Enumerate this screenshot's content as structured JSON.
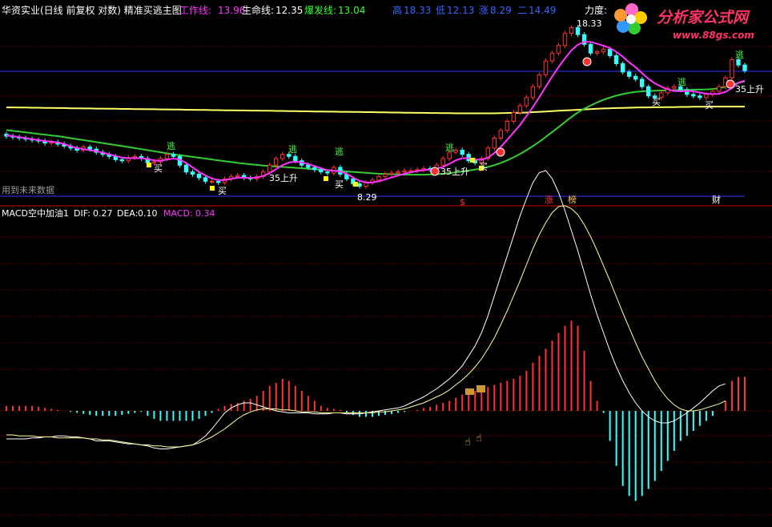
{
  "header": {
    "title": "华资实业(日线 前复权 对数) 精准买逃主图",
    "work_line": {
      "label": "工作线:",
      "value": "13.96",
      "color": "#ff33ff"
    },
    "life_line": {
      "label": "生命线:",
      "value": "12.35",
      "color": "#ffffff"
    },
    "burst_line": {
      "label": "爆发线:",
      "value": "13.04",
      "color": "#33ff33"
    },
    "ohlc": [
      {
        "label": "高",
        "value": "18.33"
      },
      {
        "label": "低",
        "value": "12.13"
      },
      {
        "label": "涨",
        "value": "8.29"
      },
      {
        "label": "二",
        "value": "14.49"
      }
    ],
    "force_label": "力度:"
  },
  "watermark": {
    "brand": "分析家公式网",
    "url": "www.88gs.com"
  },
  "future_note": "用到未来数据",
  "signals": {
    "buy": "买",
    "escape": "逃",
    "rise35": "35上升",
    "high_marker": "18.33",
    "low_marker": "8.29",
    "bottom_marks": [
      "$",
      "涨",
      "榜",
      "财"
    ]
  },
  "macd_header": {
    "name": "MACD空中加油1",
    "dif": {
      "label": "DIF:",
      "value": "0.27",
      "color": "#ffffff"
    },
    "dea": {
      "label": "DEA:",
      "value": "0.10",
      "color": "#ffffff"
    },
    "macd": {
      "label": "MACD:",
      "value": "0.34",
      "color": "#ff33ff"
    }
  },
  "colors": {
    "up": "#ff3333",
    "down": "#33ffff",
    "grid": "#8b0000",
    "ma_long": "#ffff66",
    "ma_mid": "#33cc33",
    "ma_short": "#ff33ff",
    "blue_line": "#3333ff"
  },
  "chart_data": [
    {
      "type": "candlestick",
      "title": "华资实业(日线 前复权 对数) 精准买逃主图",
      "n": 116,
      "ylim": [
        8.0,
        19.0
      ],
      "series": [
        {
          "name": "工作线",
          "value": 13.96
        },
        {
          "name": "生命线",
          "value": 12.35
        },
        {
          "name": "爆发线",
          "value": 13.04
        }
      ],
      "close": [
        10.7,
        10.65,
        10.6,
        10.55,
        10.5,
        10.45,
        10.35,
        10.4,
        10.3,
        10.2,
        10.1,
        10.0,
        10.15,
        10.05,
        9.9,
        9.8,
        9.7,
        9.55,
        9.5,
        9.65,
        9.7,
        9.6,
        9.4,
        9.45,
        9.6,
        9.8,
        9.7,
        9.3,
        9.0,
        8.9,
        8.75,
        8.6,
        8.6,
        8.55,
        8.7,
        8.8,
        8.85,
        8.75,
        8.7,
        8.8,
        9.0,
        9.3,
        9.6,
        9.8,
        9.7,
        9.5,
        9.3,
        9.2,
        9.1,
        9.0,
        8.95,
        9.2,
        8.9,
        8.7,
        8.5,
        8.4,
        8.55,
        8.65,
        8.8,
        8.9,
        8.95,
        9.0,
        9.05,
        9.05,
        9.1,
        9.15,
        9.1,
        9.3,
        9.6,
        9.9,
        10.0,
        9.8,
        9.5,
        9.4,
        9.6,
        10.1,
        10.6,
        11.0,
        11.5,
        12.0,
        12.4,
        12.9,
        13.6,
        14.4,
        15.4,
        16.0,
        16.6,
        17.6,
        18.1,
        17.5,
        16.7,
        16.0,
        16.1,
        16.3,
        15.8,
        15.2,
        14.6,
        14.3,
        14.1,
        13.6,
        13.0,
        12.9,
        13.2,
        13.5,
        13.6,
        13.4,
        13.1,
        13.0,
        12.9,
        13.1,
        13.3,
        13.6,
        14.2,
        15.5,
        15.1,
        14.7
      ],
      "ma_short": [
        10.75,
        10.7,
        10.65,
        10.6,
        10.55,
        10.5,
        10.45,
        10.42,
        10.38,
        10.3,
        10.2,
        10.1,
        10.05,
        10.0,
        9.95,
        9.88,
        9.8,
        9.72,
        9.65,
        9.62,
        9.62,
        9.62,
        9.58,
        9.52,
        9.5,
        9.55,
        9.6,
        9.55,
        9.4,
        9.2,
        9.0,
        8.85,
        8.72,
        8.65,
        8.65,
        8.7,
        8.75,
        8.75,
        8.74,
        8.76,
        8.82,
        8.95,
        9.12,
        9.3,
        9.42,
        9.46,
        9.42,
        9.35,
        9.26,
        9.16,
        9.08,
        9.05,
        9.02,
        8.92,
        8.76,
        8.62,
        8.55,
        8.55,
        8.6,
        8.68,
        8.76,
        8.84,
        8.92,
        8.98,
        9.04,
        9.08,
        9.1,
        9.14,
        9.22,
        9.36,
        9.52,
        9.62,
        9.62,
        9.56,
        9.54,
        9.64,
        9.86,
        10.16,
        10.52,
        10.9,
        11.3,
        11.8,
        12.32,
        12.92,
        13.6,
        14.28,
        14.96,
        15.6,
        16.22,
        16.66,
        16.9,
        16.9,
        16.74,
        16.58,
        16.4,
        16.1,
        15.72,
        15.3,
        14.94,
        14.52,
        14.12,
        13.82,
        13.6,
        13.42,
        13.32,
        13.3,
        13.32,
        13.3,
        13.22,
        13.14,
        13.12,
        13.14,
        13.26,
        13.5,
        13.86,
        14.0
      ],
      "ma_mid": [
        11.02,
        10.98,
        10.94,
        10.9,
        10.86,
        10.82,
        10.78,
        10.74,
        10.7,
        10.65,
        10.6,
        10.55,
        10.5,
        10.45,
        10.4,
        10.35,
        10.3,
        10.25,
        10.2,
        10.15,
        10.1,
        10.05,
        10.0,
        9.95,
        9.9,
        9.85,
        9.8,
        9.76,
        9.72,
        9.68,
        9.64,
        9.6,
        9.56,
        9.52,
        9.48,
        9.44,
        9.4,
        9.37,
        9.34,
        9.31,
        9.28,
        9.26,
        9.24,
        9.22,
        9.2,
        9.18,
        9.16,
        9.14,
        9.12,
        9.1,
        9.08,
        9.06,
        9.04,
        9.02,
        9.0,
        8.98,
        8.96,
        8.94,
        8.92,
        8.91,
        8.9,
        8.89,
        8.88,
        8.88,
        8.88,
        8.88,
        8.89,
        8.9,
        8.92,
        8.95,
        8.98,
        9.02,
        9.06,
        9.1,
        9.16,
        9.22,
        9.3,
        9.4,
        9.52,
        9.66,
        9.82,
        10.0,
        10.2,
        10.42,
        10.66,
        10.92,
        11.18,
        11.46,
        11.74,
        12.0,
        12.22,
        12.42,
        12.6,
        12.76,
        12.9,
        13.02,
        13.12,
        13.2,
        13.26,
        13.3,
        13.32,
        13.34,
        13.35,
        13.36,
        13.37,
        13.38,
        13.39,
        13.4,
        13.41,
        13.42,
        13.45,
        13.5,
        13.6,
        13.72,
        13.85,
        13.96
      ],
      "ma_long": [
        12.3,
        12.3,
        12.29,
        12.29,
        12.28,
        12.28,
        12.27,
        12.27,
        12.26,
        12.26,
        12.25,
        12.25,
        12.24,
        12.24,
        12.23,
        12.23,
        12.22,
        12.22,
        12.21,
        12.21,
        12.2,
        12.2,
        12.19,
        12.19,
        12.18,
        12.18,
        12.17,
        12.17,
        12.16,
        12.16,
        12.15,
        12.15,
        12.14,
        12.14,
        12.13,
        12.13,
        12.12,
        12.12,
        12.11,
        12.11,
        12.1,
        12.1,
        12.09,
        12.09,
        12.08,
        12.08,
        12.07,
        12.07,
        12.06,
        12.06,
        12.05,
        12.05,
        12.04,
        12.04,
        12.03,
        12.03,
        12.02,
        12.02,
        12.01,
        12.01,
        12.0,
        12.0,
        11.99,
        11.99,
        11.98,
        11.98,
        11.97,
        11.97,
        11.96,
        11.96,
        11.95,
        11.95,
        11.95,
        11.95,
        11.95,
        11.95,
        11.95,
        11.96,
        11.97,
        11.98,
        11.99,
        12.0,
        12.02,
        12.04,
        12.06,
        12.08,
        12.1,
        12.12,
        12.14,
        12.16,
        12.18,
        12.2,
        12.22,
        12.24,
        12.25,
        12.26,
        12.27,
        12.28,
        12.29,
        12.3,
        12.3,
        12.31,
        12.31,
        12.32,
        12.32,
        12.33,
        12.33,
        12.34,
        12.34,
        12.34,
        12.35,
        12.35,
        12.35,
        12.35,
        12.35,
        12.35
      ]
    },
    {
      "type": "bar",
      "title": "MACD空中加油1",
      "series": [
        {
          "name": "DIF",
          "value": 0.27
        },
        {
          "name": "DEA",
          "value": 0.1
        },
        {
          "name": "MACD",
          "value": 0.34
        }
      ],
      "hist": [
        0.05,
        0.05,
        0.05,
        0.05,
        0.05,
        0.04,
        0.03,
        0.02,
        0.01,
        0.0,
        -0.01,
        -0.02,
        -0.03,
        -0.04,
        -0.05,
        -0.05,
        -0.05,
        -0.05,
        -0.04,
        -0.03,
        -0.02,
        -0.01,
        -0.05,
        -0.08,
        -0.1,
        -0.1,
        -0.1,
        -0.1,
        -0.1,
        -0.1,
        -0.08,
        -0.05,
        -0.02,
        0.02,
        0.05,
        0.07,
        0.08,
        0.1,
        0.12,
        0.15,
        0.2,
        0.25,
        0.28,
        0.32,
        0.3,
        0.25,
        0.2,
        0.15,
        0.1,
        0.05,
        0.03,
        0.02,
        0.01,
        -0.02,
        -0.04,
        -0.06,
        -0.06,
        -0.06,
        -0.05,
        -0.04,
        -0.03,
        -0.02,
        -0.01,
        0.0,
        0.01,
        0.03,
        0.04,
        0.06,
        0.08,
        0.1,
        0.13,
        0.16,
        0.18,
        0.2,
        0.22,
        0.24,
        0.26,
        0.28,
        0.3,
        0.32,
        0.35,
        0.4,
        0.48,
        0.55,
        0.62,
        0.7,
        0.78,
        0.85,
        0.9,
        0.85,
        0.6,
        0.3,
        0.1,
        -0.02,
        -0.3,
        -0.55,
        -0.75,
        -0.85,
        -0.9,
        -0.85,
        -0.78,
        -0.7,
        -0.6,
        -0.5,
        -0.4,
        -0.3,
        -0.25,
        -0.2,
        -0.15,
        -0.1,
        -0.05,
        0.0,
        0.1,
        0.3,
        0.34,
        0.34
      ],
      "dif": [
        -0.28,
        -0.28,
        -0.28,
        -0.28,
        -0.27,
        -0.27,
        -0.26,
        -0.26,
        -0.25,
        -0.25,
        -0.26,
        -0.26,
        -0.27,
        -0.28,
        -0.3,
        -0.3,
        -0.3,
        -0.31,
        -0.32,
        -0.33,
        -0.33,
        -0.34,
        -0.35,
        -0.37,
        -0.38,
        -0.38,
        -0.37,
        -0.36,
        -0.35,
        -0.34,
        -0.3,
        -0.25,
        -0.18,
        -0.1,
        -0.02,
        0.03,
        0.06,
        0.08,
        0.08,
        0.06,
        0.04,
        0.02,
        0.0,
        -0.01,
        -0.02,
        -0.02,
        -0.02,
        -0.02,
        -0.03,
        -0.03,
        -0.03,
        -0.02,
        -0.02,
        -0.03,
        -0.03,
        -0.03,
        -0.02,
        -0.01,
        0.0,
        0.01,
        0.02,
        0.03,
        0.05,
        0.08,
        0.11,
        0.14,
        0.18,
        0.22,
        0.27,
        0.32,
        0.38,
        0.45,
        0.55,
        0.65,
        0.78,
        0.95,
        1.15,
        1.35,
        1.55,
        1.75,
        1.95,
        2.12,
        2.28,
        2.38,
        2.4,
        2.32,
        2.18,
        2.0,
        1.8,
        1.6,
        1.38,
        1.16,
        0.96,
        0.78,
        0.6,
        0.44,
        0.3,
        0.18,
        0.08,
        0.0,
        -0.06,
        -0.1,
        -0.12,
        -0.12,
        -0.1,
        -0.06,
        -0.02,
        0.03,
        0.08,
        0.14,
        0.2,
        0.25,
        0.27
      ],
      "dea": [
        -0.24,
        -0.24,
        -0.25,
        -0.25,
        -0.25,
        -0.26,
        -0.26,
        -0.26,
        -0.27,
        -0.27,
        -0.27,
        -0.27,
        -0.27,
        -0.28,
        -0.28,
        -0.29,
        -0.29,
        -0.3,
        -0.31,
        -0.32,
        -0.33,
        -0.34,
        -0.34,
        -0.35,
        -0.35,
        -0.36,
        -0.36,
        -0.36,
        -0.35,
        -0.34,
        -0.32,
        -0.29,
        -0.26,
        -0.22,
        -0.18,
        -0.13,
        -0.08,
        -0.04,
        -0.01,
        0.01,
        0.02,
        0.02,
        0.02,
        0.01,
        0.01,
        0.0,
        -0.01,
        -0.01,
        -0.01,
        -0.02,
        -0.02,
        -0.02,
        -0.02,
        -0.02,
        -0.02,
        -0.02,
        -0.02,
        -0.02,
        -0.01,
        -0.01,
        0.0,
        0.01,
        0.02,
        0.04,
        0.06,
        0.08,
        0.11,
        0.14,
        0.17,
        0.21,
        0.26,
        0.31,
        0.37,
        0.44,
        0.52,
        0.62,
        0.73,
        0.86,
        1.0,
        1.15,
        1.3,
        1.46,
        1.62,
        1.76,
        1.88,
        1.98,
        2.04,
        2.05,
        2.02,
        1.96,
        1.86,
        1.74,
        1.6,
        1.45,
        1.3,
        1.14,
        0.98,
        0.83,
        0.68,
        0.54,
        0.42,
        0.3,
        0.2,
        0.12,
        0.06,
        0.02,
        0.0,
        0.0,
        0.01,
        0.03,
        0.05,
        0.07,
        0.1
      ]
    }
  ]
}
